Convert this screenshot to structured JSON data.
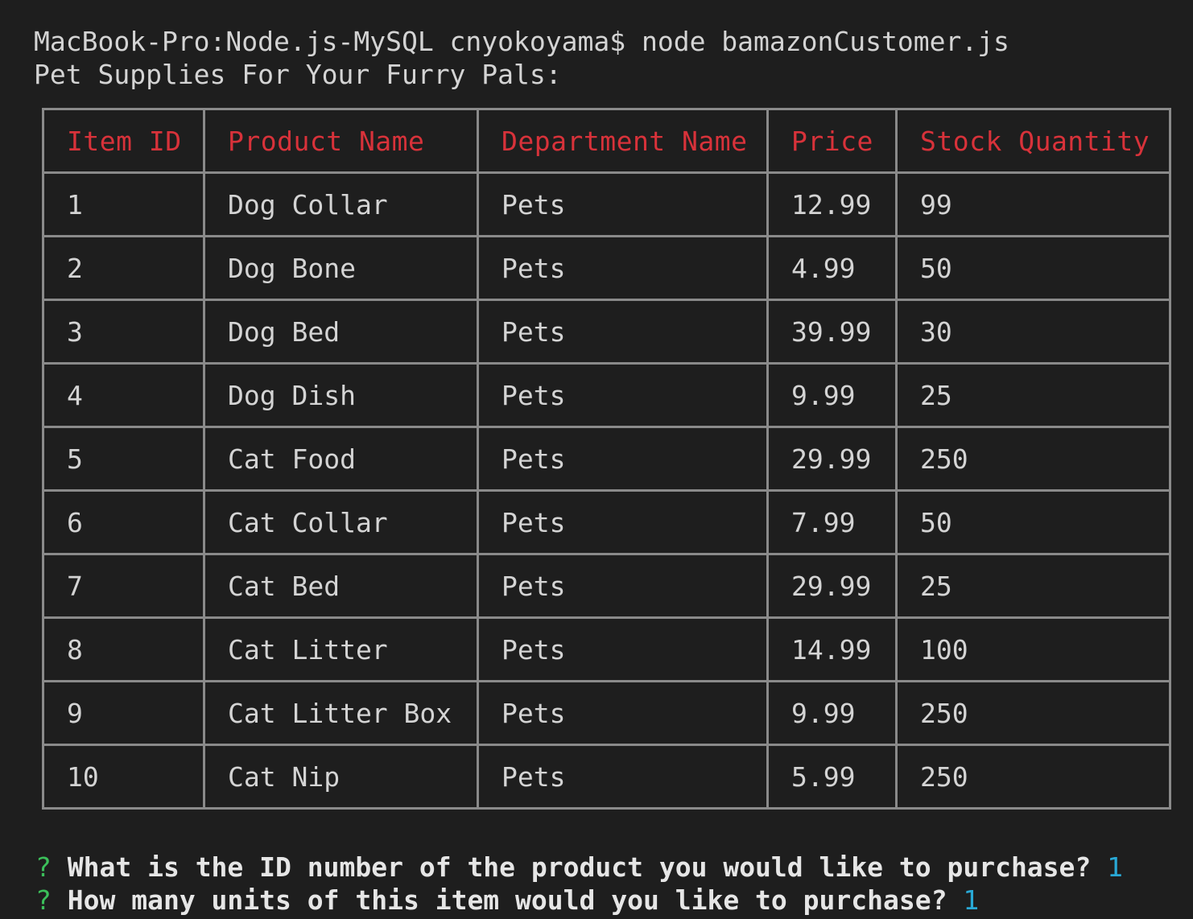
{
  "terminal": {
    "command_line": "MacBook-Pro:Node.js-MySQL cnyokoyama$ node bamazonCustomer.js",
    "title_line": "Pet Supplies For Your Furry Pals:"
  },
  "table": {
    "headers": [
      "Item ID",
      "Product Name",
      "Department Name",
      "Price",
      "Stock Quantity"
    ],
    "rows": [
      [
        "1",
        "Dog Collar",
        "Pets",
        "12.99",
        "99"
      ],
      [
        "2",
        "Dog Bone",
        "Pets",
        "4.99",
        "50"
      ],
      [
        "3",
        "Dog Bed",
        "Pets",
        "39.99",
        "30"
      ],
      [
        "4",
        "Dog Dish",
        "Pets",
        "9.99",
        "25"
      ],
      [
        "5",
        "Cat Food",
        "Pets",
        "29.99",
        "250"
      ],
      [
        "6",
        "Cat Collar",
        "Pets",
        "7.99",
        "50"
      ],
      [
        "7",
        "Cat Bed",
        "Pets",
        "29.99",
        "25"
      ],
      [
        "8",
        "Cat Litter",
        "Pets",
        "14.99",
        "100"
      ],
      [
        "9",
        "Cat Litter Box",
        "Pets",
        "9.99",
        "250"
      ],
      [
        "10",
        "Cat Nip",
        "Pets",
        "5.99",
        "250"
      ]
    ]
  },
  "prompts": [
    {
      "mark": "?",
      "question": "What is the ID number of the product you would like to purchase?",
      "answer": "1"
    },
    {
      "mark": "?",
      "question": "How many units of this item would you like to purchase?",
      "answer": "1"
    }
  ],
  "colors": {
    "background": "#1e1e1e",
    "header_text": "#d8323a",
    "prompt_mark": "#3bbf5a",
    "answer": "#29a9d6",
    "border": "#8a8a8a"
  }
}
